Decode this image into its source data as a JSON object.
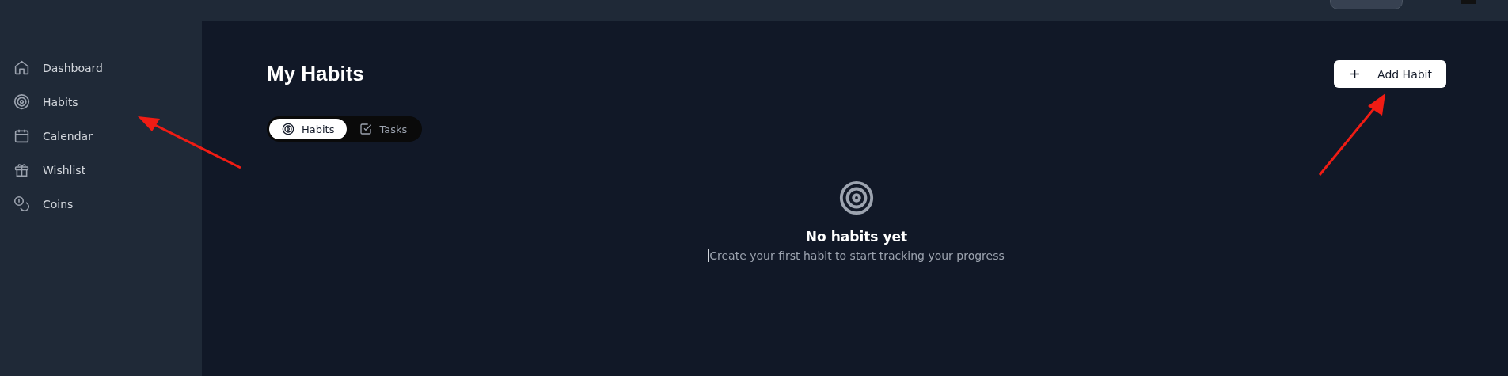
{
  "sidebar": {
    "items": [
      {
        "label": "Dashboard",
        "kind": "home"
      },
      {
        "label": "Habits",
        "kind": "target"
      },
      {
        "label": "Calendar",
        "kind": "calendar"
      },
      {
        "label": "Wishlist",
        "kind": "gift"
      },
      {
        "label": "Coins",
        "kind": "coins"
      }
    ]
  },
  "page": {
    "title": "My Habits",
    "add_button": {
      "label": "Add Habit"
    }
  },
  "tabs": [
    {
      "label": "Habits",
      "kind": "target",
      "selected": true
    },
    {
      "label": "Tasks",
      "kind": "check",
      "selected": false
    }
  ],
  "empty_state": {
    "title": "No habits yet",
    "text": "Create your first habit to start tracking your progress"
  }
}
